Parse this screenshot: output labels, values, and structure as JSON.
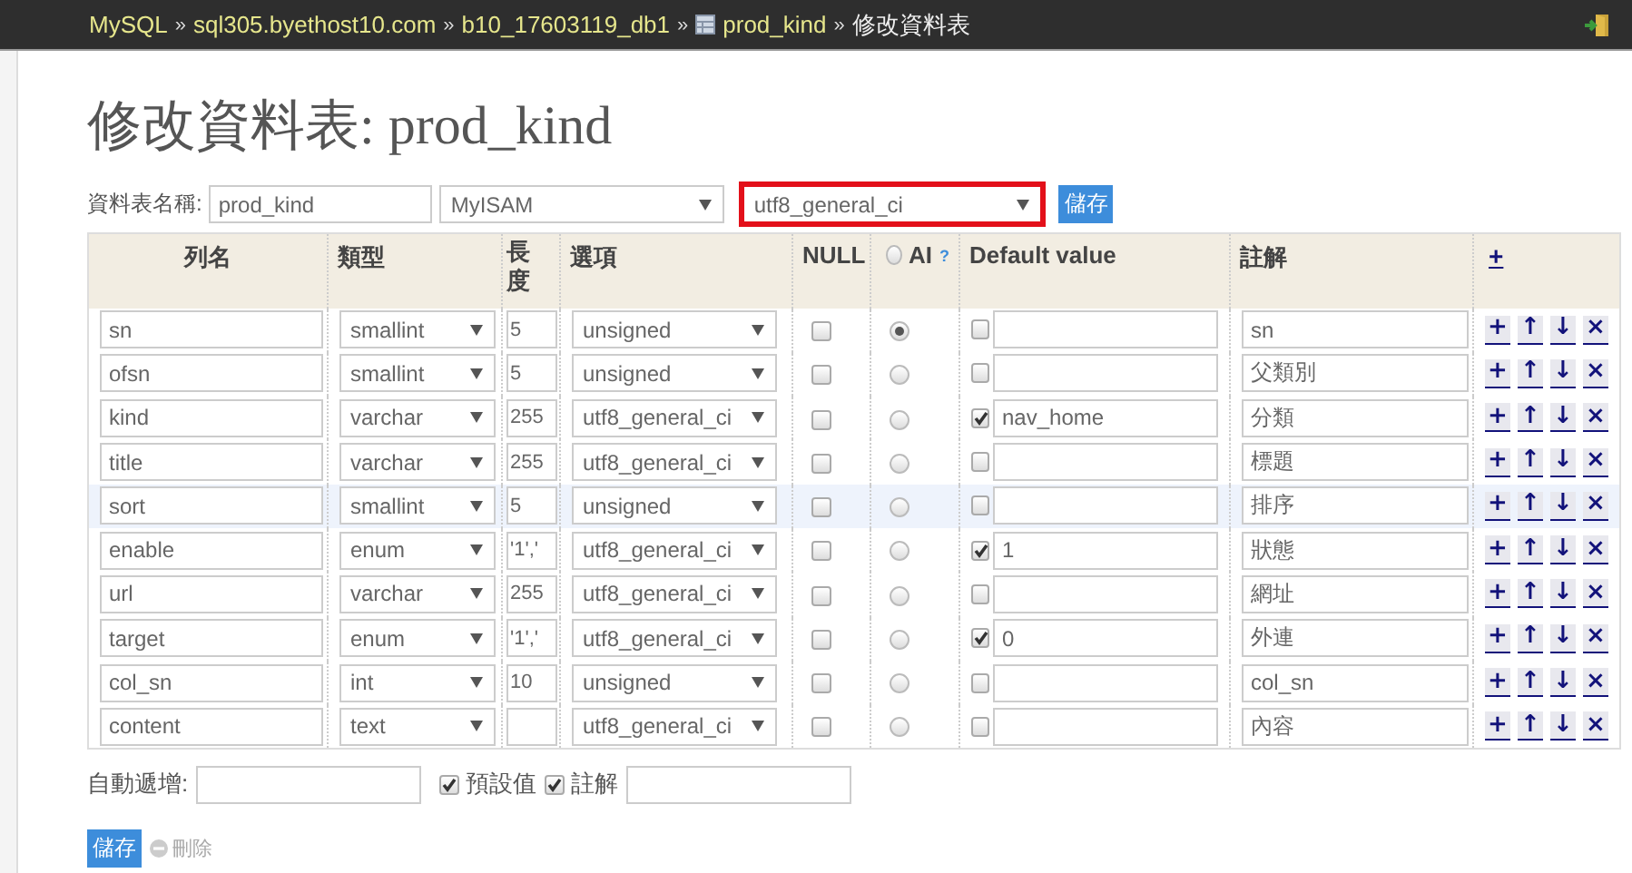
{
  "breadcrumb": [
    {
      "text": "MySQL",
      "kind": "link"
    },
    {
      "prefix": "»",
      "text": "sql305.byethost10.com",
      "kind": "link"
    },
    {
      "prefix": "»",
      "text": "b10_17603119_db1",
      "kind": "link"
    },
    {
      "prefix": "»",
      "text": "prod_kind",
      "kind": "table"
    },
    {
      "prefix": "»",
      "text": "修改資料表",
      "kind": "current"
    }
  ],
  "title": "修改資料表: prod_kind",
  "table_form": {
    "label": "資料表名稱:",
    "name": "prod_kind",
    "engine": "MyISAM",
    "collation": "utf8_general_ci",
    "collation_highlighted": true,
    "save": "儲存"
  },
  "headers": {
    "name": "列名",
    "type": "類型",
    "length": "長度",
    "options": "選項",
    "null": "NULL",
    "ai": "AI",
    "ai_help": "?",
    "ai_selected": false,
    "default": "Default value",
    "comment": "註解",
    "add": "+"
  },
  "columns": [
    {
      "name": "sn",
      "type": "smallint",
      "length": "5",
      "options": "unsigned",
      "null": false,
      "auto_increment": true,
      "has_default": false,
      "comment": "sn",
      "highlighted": false,
      "actions": [
        "+",
        "↑",
        "↓",
        "×"
      ]
    },
    {
      "name": "ofsn",
      "type": "smallint",
      "length": "5",
      "options": "unsigned",
      "null": false,
      "auto_increment": false,
      "has_default": false,
      "comment": "父類別",
      "highlighted": false,
      "actions": [
        "+",
        "↑",
        "↓",
        "×"
      ]
    },
    {
      "name": "kind",
      "type": "varchar",
      "length": "255",
      "options": "utf8_general_ci",
      "null": false,
      "auto_increment": false,
      "has_default": true,
      "default": "nav_home",
      "comment": "分類",
      "highlighted": false,
      "actions": [
        "+",
        "↑",
        "↓",
        "×"
      ]
    },
    {
      "name": "title",
      "type": "varchar",
      "length": "255",
      "options": "utf8_general_ci",
      "null": false,
      "auto_increment": false,
      "has_default": false,
      "comment": "標題",
      "highlighted": false,
      "actions": [
        "+",
        "↑",
        "↓",
        "×"
      ]
    },
    {
      "name": "sort",
      "type": "smallint",
      "length": "5",
      "options": "unsigned",
      "null": false,
      "auto_increment": false,
      "has_default": false,
      "comment": "排序",
      "highlighted": true,
      "actions": [
        "+",
        "↑",
        "↓",
        "×"
      ]
    },
    {
      "name": "enable",
      "type": "enum",
      "length": "'1','",
      "options": "utf8_general_ci",
      "null": false,
      "auto_increment": false,
      "has_default": true,
      "default": "1",
      "comment": "狀態",
      "highlighted": false,
      "actions": [
        "+",
        "↑",
        "↓",
        "×"
      ]
    },
    {
      "name": "url",
      "type": "varchar",
      "length": "255",
      "options": "utf8_general_ci",
      "null": false,
      "auto_increment": false,
      "has_default": false,
      "comment": "網址",
      "highlighted": false,
      "actions": [
        "+",
        "↑",
        "↓",
        "×"
      ]
    },
    {
      "name": "target",
      "type": "enum",
      "length": "'1','",
      "options": "utf8_general_ci",
      "null": false,
      "auto_increment": false,
      "has_default": true,
      "default": "0",
      "comment": "外連",
      "highlighted": false,
      "actions": [
        "+",
        "↑",
        "↓",
        "×"
      ]
    },
    {
      "name": "col_sn",
      "type": "int",
      "length": "10",
      "options": "unsigned",
      "null": false,
      "auto_increment": false,
      "has_default": false,
      "comment": "col_sn",
      "highlighted": false,
      "actions": [
        "+",
        "↑",
        "↓",
        "×"
      ]
    },
    {
      "name": "content",
      "type": "text",
      "options": "utf8_general_ci",
      "null": false,
      "auto_increment": false,
      "has_default": false,
      "comment": "內容",
      "highlighted": false,
      "actions": [
        "+",
        "↑",
        "↓",
        "×"
      ]
    }
  ],
  "footer": {
    "auto_increment_label": "自動遞增:",
    "defaults": {
      "label": "預設值",
      "checked": true
    },
    "comments": {
      "label": "註解",
      "checked": true
    },
    "save": "儲存",
    "drop": {
      "label": "刪除",
      "disabled": true
    }
  }
}
